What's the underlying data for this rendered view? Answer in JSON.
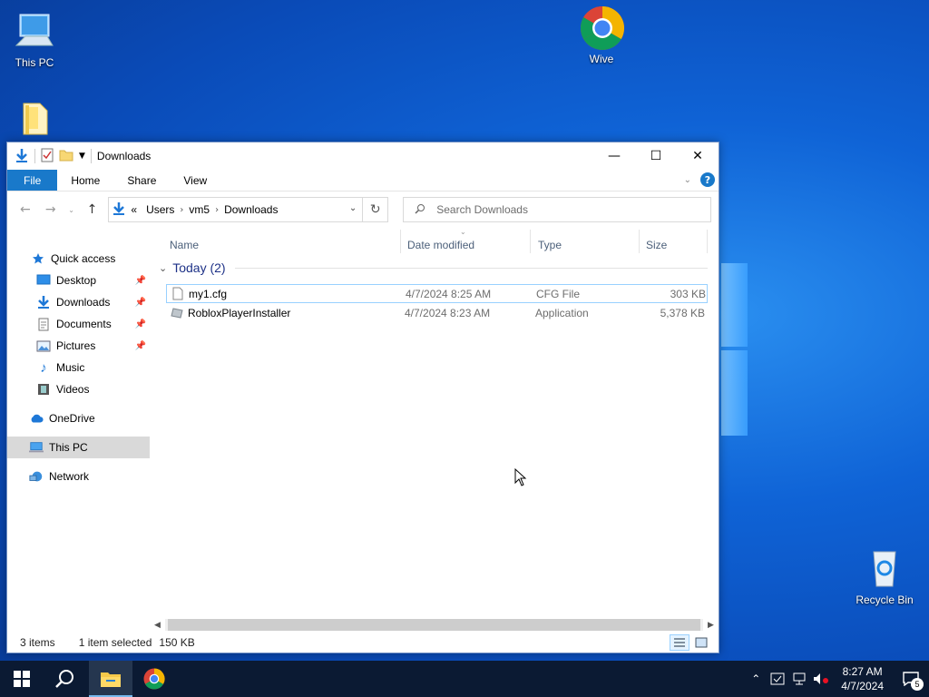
{
  "desktop": {
    "icons": {
      "this_pc": "This PC",
      "wive": "Wive",
      "recycle_bin": "Recycle Bin"
    }
  },
  "window": {
    "title": "Downloads",
    "controls": {
      "minimize": "—",
      "maximize": "☐",
      "close": "✕"
    },
    "ribbon_tabs": [
      "File",
      "Home",
      "Share",
      "View"
    ],
    "address": {
      "overflow": "«",
      "crumbs": [
        "Users",
        "vm5",
        "Downloads"
      ]
    },
    "search": {
      "placeholder": "Search Downloads"
    },
    "sidebar": {
      "quick_access": "Quick access",
      "pinned": [
        "Desktop",
        "Downloads",
        "Documents",
        "Pictures"
      ],
      "other": [
        "Music",
        "Videos"
      ],
      "onedrive": "OneDrive",
      "this_pc": "This PC",
      "network": "Network"
    },
    "columns": {
      "name": "Name",
      "date": "Date modified",
      "type": "Type",
      "size": "Size"
    },
    "group": "Today (2)",
    "files": [
      {
        "name": "my1.cfg",
        "date": "4/7/2024 8:25 AM",
        "type": "CFG File",
        "size": "303 KB"
      },
      {
        "name": "RobloxPlayerInstaller",
        "date": "4/7/2024 8:23 AM",
        "type": "Application",
        "size": "5,378 KB"
      }
    ],
    "status": {
      "items": "3 items",
      "selected": "1 item selected",
      "size": "150 KB"
    }
  },
  "taskbar": {
    "clock_time": "8:27 AM",
    "clock_date": "4/7/2024",
    "notification_count": "5"
  }
}
